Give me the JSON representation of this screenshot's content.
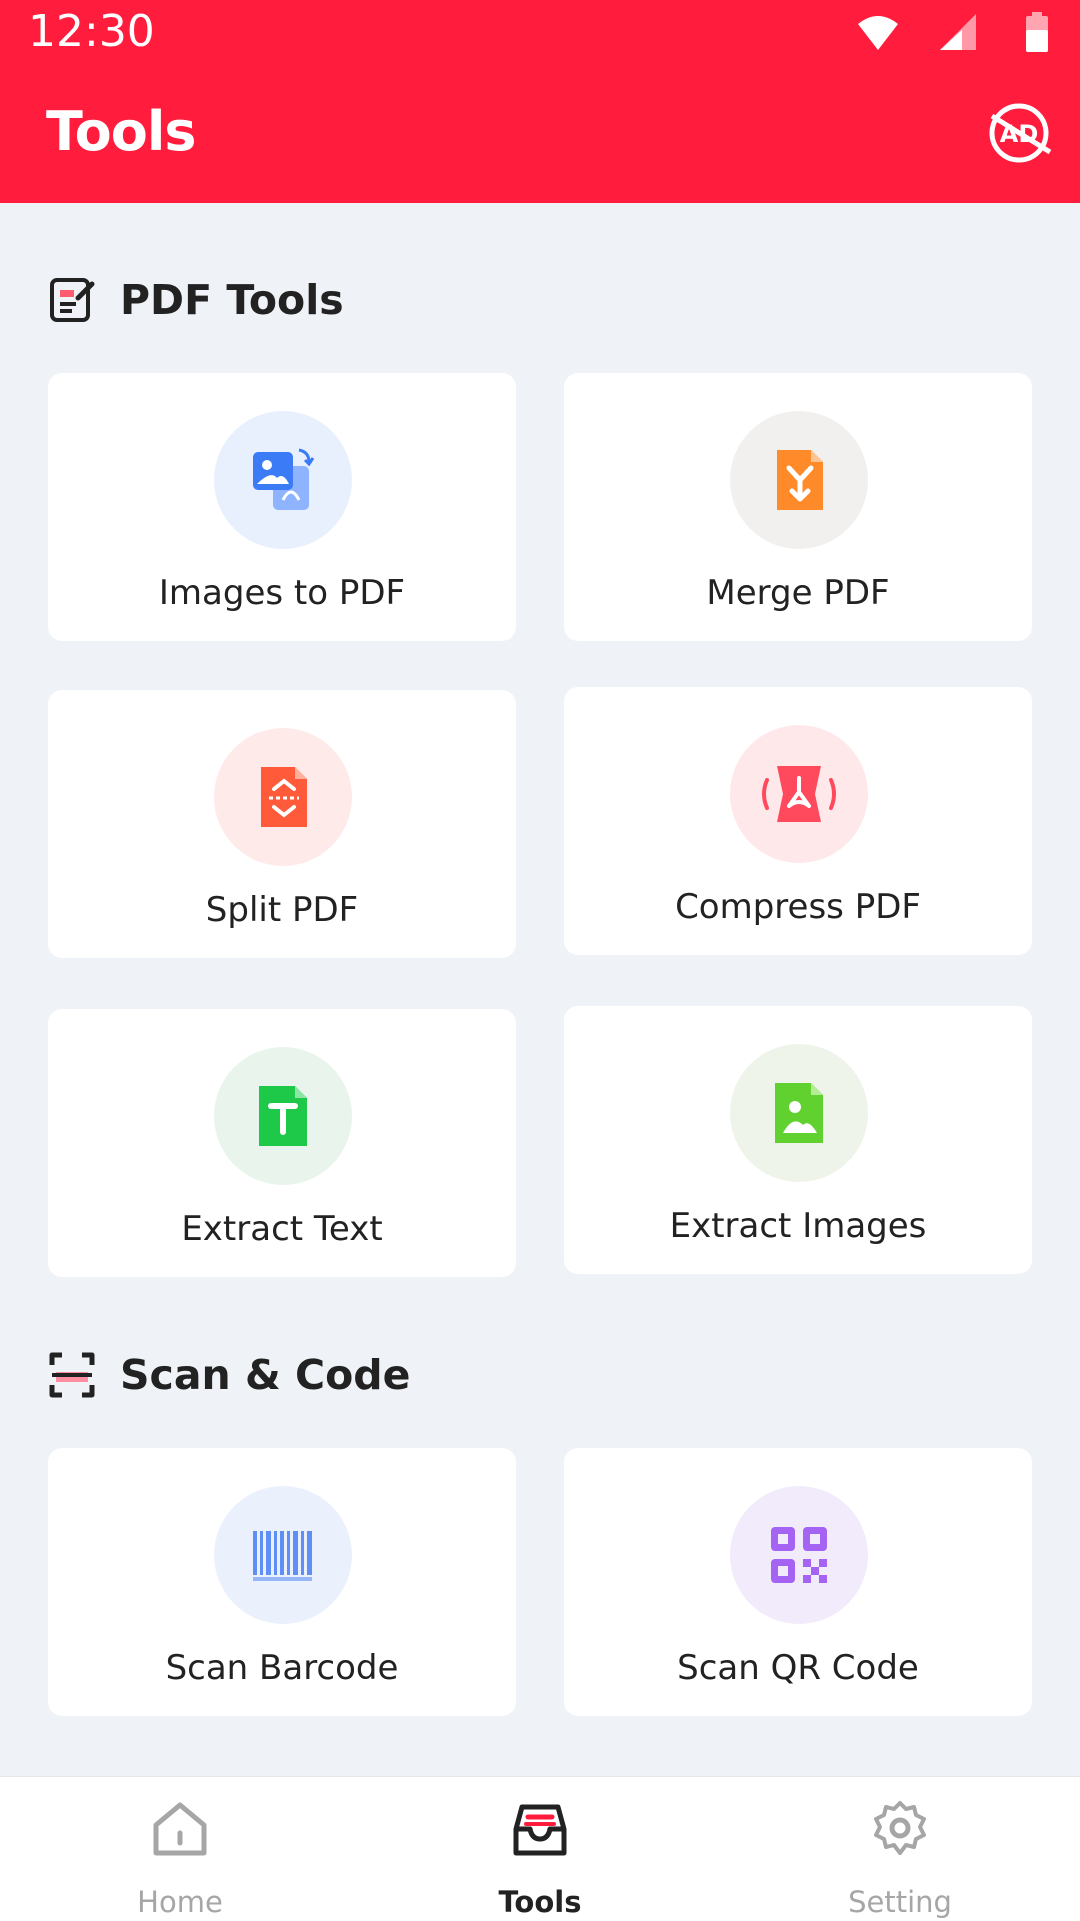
{
  "status_bar": {
    "time": "12:30"
  },
  "header": {
    "title": "Tools",
    "no_ads_icon": "no-ads-icon"
  },
  "sections": [
    {
      "title": "PDF Tools",
      "icon": "pdf-tools-icon",
      "items": [
        {
          "label": "Images to PDF",
          "icon": "images-to-pdf-icon"
        },
        {
          "label": "Merge PDF",
          "icon": "merge-pdf-icon"
        },
        {
          "label": "Split PDF",
          "icon": "split-pdf-icon"
        },
        {
          "label": "Compress PDF",
          "icon": "compress-pdf-icon"
        },
        {
          "label": "Extract Text",
          "icon": "extract-text-icon"
        },
        {
          "label": "Extract Images",
          "icon": "extract-images-icon"
        }
      ]
    },
    {
      "title": "Scan & Code",
      "icon": "scan-code-icon",
      "items": [
        {
          "label": "Scan Barcode",
          "icon": "barcode-icon"
        },
        {
          "label": "Scan QR Code",
          "icon": "qr-code-icon"
        }
      ]
    }
  ],
  "bottom_nav": {
    "items": [
      {
        "label": "Home",
        "icon": "home-icon",
        "active": false
      },
      {
        "label": "Tools",
        "icon": "tools-tray-icon",
        "active": true
      },
      {
        "label": "Setting",
        "icon": "gear-icon",
        "active": false
      }
    ]
  },
  "colors": {
    "accent": "#ff1c3c",
    "background": "#eff2f6",
    "nav_active": "#222222",
    "nav_inactive": "#a6a6a6"
  }
}
